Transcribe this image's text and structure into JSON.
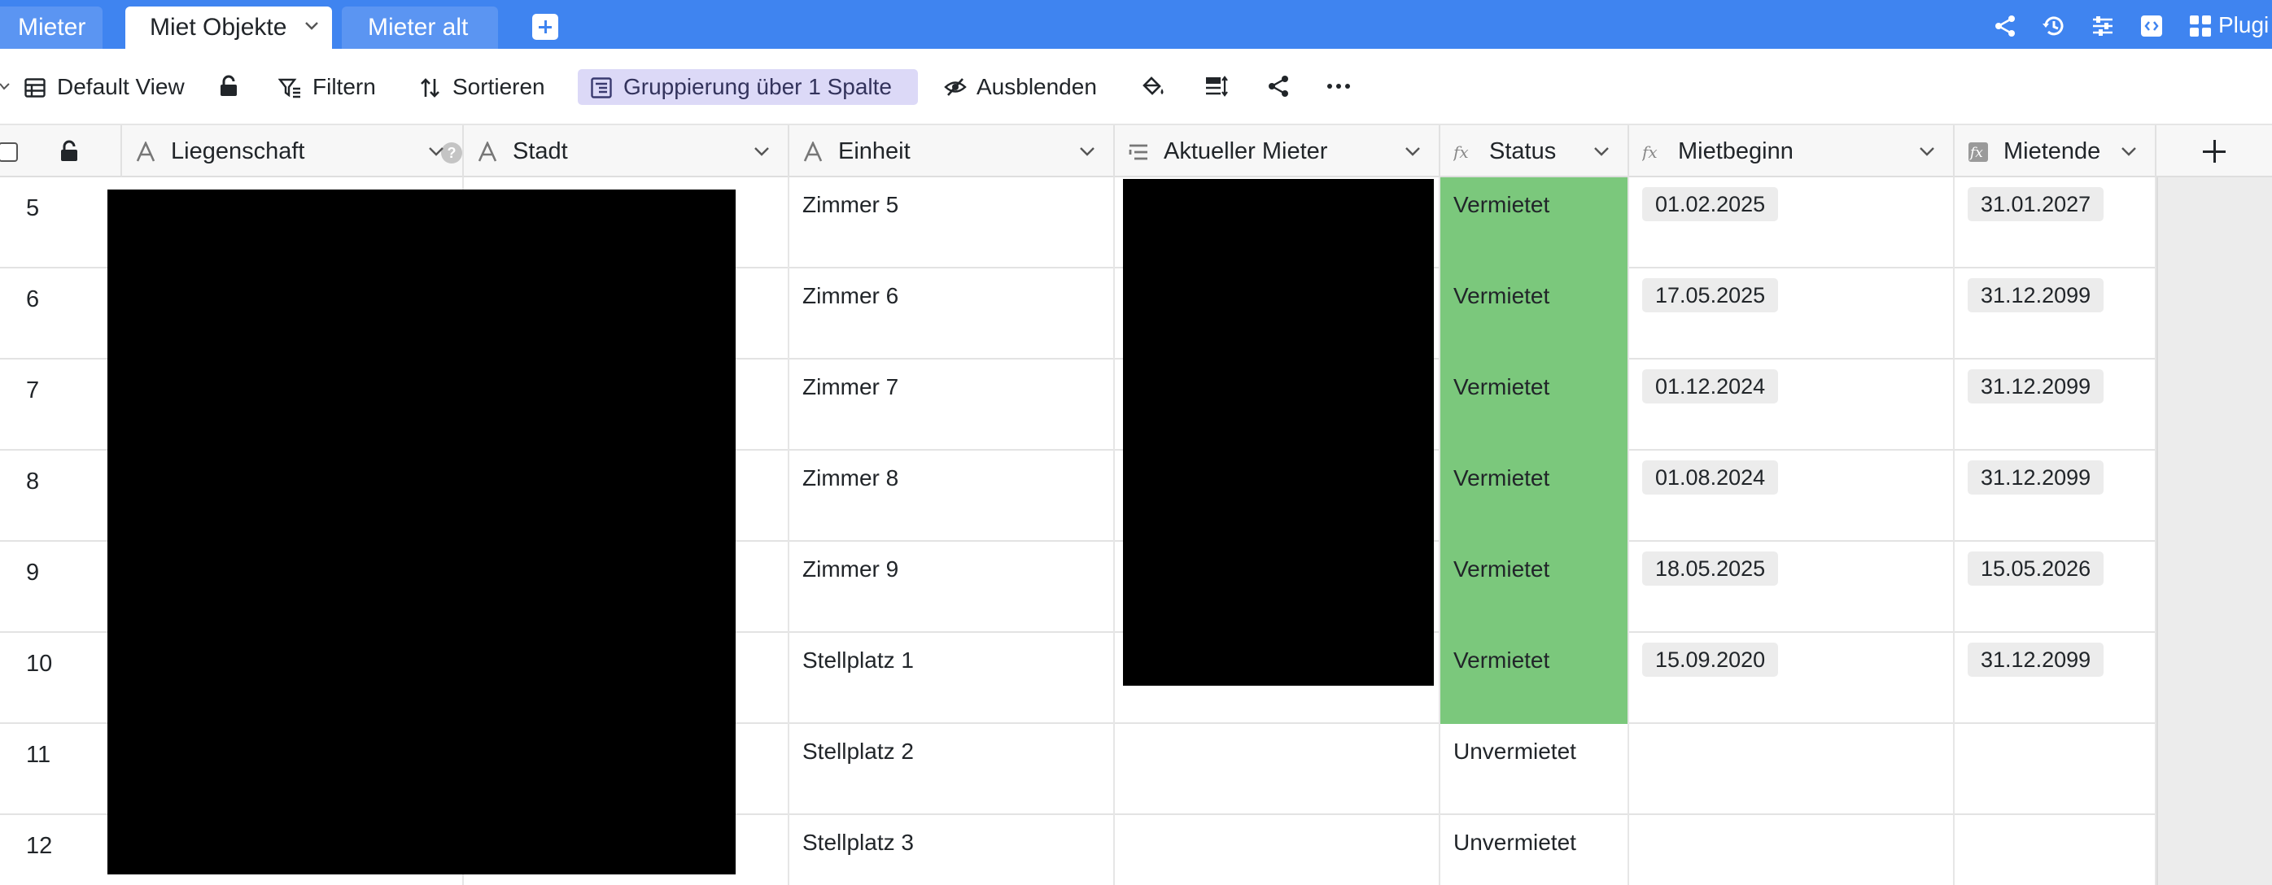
{
  "tabs": [
    {
      "label": "Mieter"
    },
    {
      "label": "Miet Objekte"
    },
    {
      "label": "Mieter alt"
    }
  ],
  "top_icons": [
    "share-icon",
    "history-icon",
    "sliders-icon",
    "code-icon",
    "plugins-icon"
  ],
  "plugins_label": "Plugi",
  "toolbar": {
    "view_label": "Default View",
    "filter_label": "Filtern",
    "sort_label": "Sortieren",
    "group_label": "Gruppierung über 1 Spalte",
    "hide_label": "Ausblenden",
    "colors": {
      "toolbar_blue": "#3f84f0",
      "grouping_bg": "#dcd9f7"
    }
  },
  "columns": [
    {
      "label": "Liegenschaft",
      "type_icon": "text-type-icon",
      "has_help": true
    },
    {
      "label": "Stadt",
      "type_icon": "text-type-icon"
    },
    {
      "label": "Einheit",
      "type_icon": "text-type-icon"
    },
    {
      "label": "Aktueller Mieter",
      "type_icon": "link-type-icon"
    },
    {
      "label": "Status",
      "type_icon": "formula-type-icon"
    },
    {
      "label": "Mietbeginn",
      "type_icon": "formula-type-icon"
    },
    {
      "label": "Mietende",
      "type_icon": "formula-type-icon"
    }
  ],
  "rows": [
    {
      "num": "5",
      "einheit": "Zimmer 5",
      "status": "Vermietet",
      "mietbeginn": "01.02.2025",
      "mietende": "31.01.2027"
    },
    {
      "num": "6",
      "einheit": "Zimmer 6",
      "status": "Vermietet",
      "mietbeginn": "17.05.2025",
      "mietende": "31.12.2099"
    },
    {
      "num": "7",
      "einheit": "Zimmer 7",
      "status": "Vermietet",
      "mietbeginn": "01.12.2024",
      "mietende": "31.12.2099"
    },
    {
      "num": "8",
      "einheit": "Zimmer 8",
      "status": "Vermietet",
      "mietbeginn": "01.08.2024",
      "mietende": "31.12.2099"
    },
    {
      "num": "9",
      "einheit": "Zimmer 9",
      "status": "Vermietet",
      "mietbeginn": "18.05.2025",
      "mietende": "15.05.2026"
    },
    {
      "num": "10",
      "einheit": "Stellplatz 1",
      "status": "Vermietet",
      "mietbeginn": "15.09.2020",
      "mietende": "31.12.2099"
    },
    {
      "num": "11",
      "einheit": "Stellplatz 2",
      "status": "Unvermietet",
      "mietbeginn": "",
      "mietende": ""
    },
    {
      "num": "12",
      "einheit": "Stellplatz 3",
      "status": "Unvermietet",
      "mietbeginn": "",
      "mietende": ""
    }
  ],
  "colors": {
    "status_rented_bg": "#7bc87c"
  }
}
